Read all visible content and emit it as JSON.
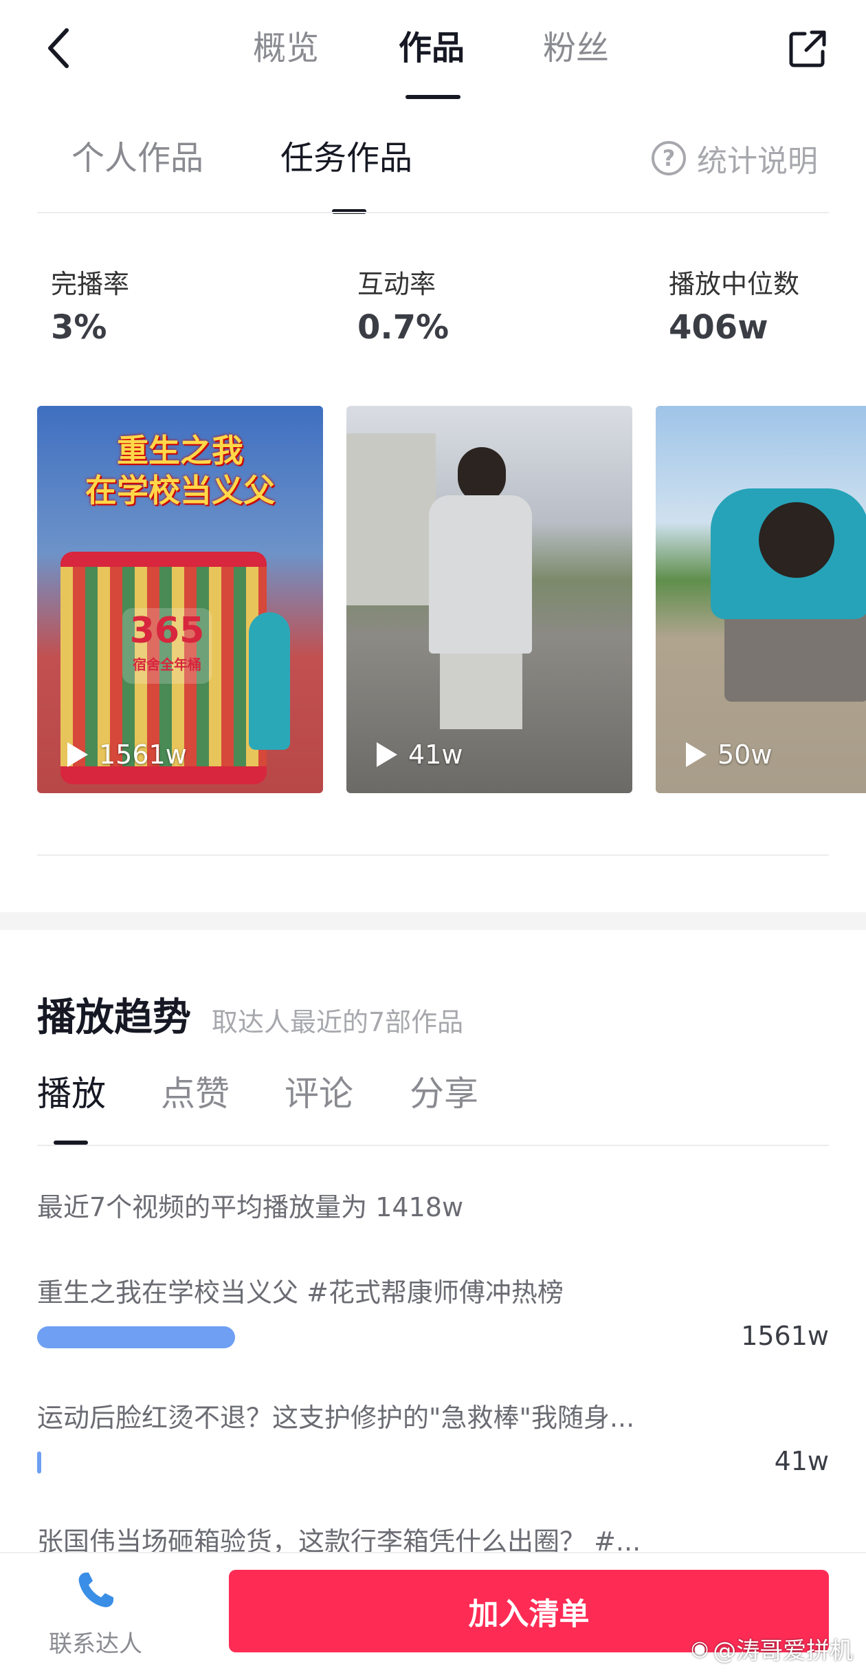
{
  "header": {
    "tabs": [
      {
        "label": "概览",
        "active": false
      },
      {
        "label": "作品",
        "active": true
      },
      {
        "label": "粉丝",
        "active": false
      }
    ],
    "icons": {
      "back": "chevron-left-icon",
      "share": "external-link-icon"
    }
  },
  "sub_tabs": {
    "items": [
      {
        "label": "个人作品",
        "active": false
      },
      {
        "label": "任务作品",
        "active": true
      }
    ],
    "help_label": "统计说明",
    "help_icon": "question-circle-icon"
  },
  "stats": [
    {
      "label": "完播率",
      "value": "3%"
    },
    {
      "label": "互动率",
      "value": "0.7%"
    },
    {
      "label": "播放中位数",
      "value": "406w"
    }
  ],
  "videos": [
    {
      "views": "1561w",
      "overlay_line1": "重生之我",
      "overlay_line2": "在学校当义父",
      "badge": "365",
      "badge_sub": "宿舍全年桶"
    },
    {
      "views": "41w"
    },
    {
      "views": "50w"
    }
  ],
  "trend": {
    "title": "播放趋势",
    "subtitle": "取达人最近的7部作品",
    "metric_tabs": [
      {
        "label": "播放",
        "active": true
      },
      {
        "label": "点赞",
        "active": false
      },
      {
        "label": "评论",
        "active": false
      },
      {
        "label": "分享",
        "active": false
      }
    ],
    "average_text": "最近7个视频的平均播放量为 1418w",
    "rows": [
      {
        "title": "重生之我在学校当义父 #花式帮康师傅冲热榜",
        "value": "1561w",
        "fraction": 0.288
      },
      {
        "title": "运动后脸红烫不退？这支护修护的\"急救棒\"我随身...",
        "value": "41w",
        "fraction": 0.006
      },
      {
        "title": "张国伟当场砸箱验货，这款行李箱凭什么出圈？ #...",
        "value": "",
        "fraction": 0
      }
    ]
  },
  "bottom": {
    "contact_label": "联系达人",
    "contact_icon": "phone-icon",
    "add_button": "加入清单",
    "watermark": "@涛哥爱拼机"
  },
  "colors": {
    "accent": "#fe2c55",
    "bar": "#6e9ff2"
  }
}
